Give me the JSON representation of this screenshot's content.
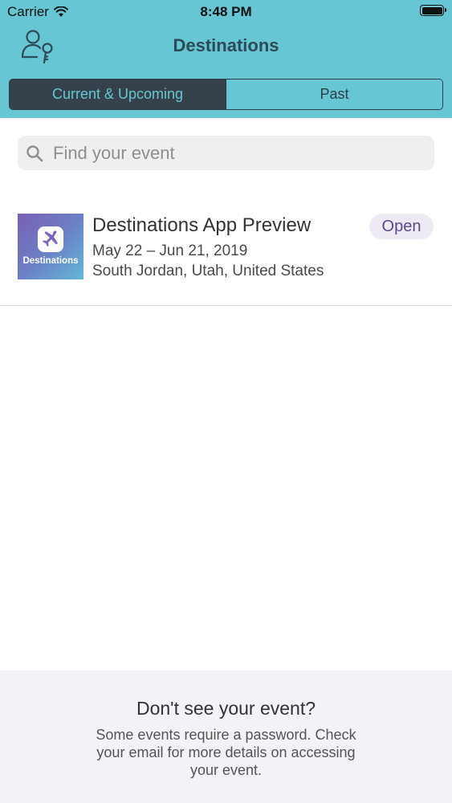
{
  "status_bar": {
    "carrier": "Carrier",
    "time": "8:48 PM"
  },
  "nav": {
    "title": "Destinations",
    "left_icon": "user-key-icon"
  },
  "segments": {
    "items": [
      {
        "label": "Current & Upcoming",
        "selected": true
      },
      {
        "label": "Past",
        "selected": false
      }
    ]
  },
  "search": {
    "placeholder": "Find your event",
    "value": ""
  },
  "events": [
    {
      "logo_text": "Destinations",
      "title": "Destinations App Preview",
      "dates": "May 22 – Jun 21, 2019",
      "location": "South Jordan, Utah, United States",
      "status": "Open"
    }
  ],
  "footer": {
    "title": "Don't see your event?",
    "message": "Some events require a password. Check your email for more details on accessing your event."
  },
  "colors": {
    "header": "#66c6d4",
    "segment_active": "#36424b",
    "badge_bg": "#eeeaf4",
    "badge_text": "#5b4a8a"
  }
}
